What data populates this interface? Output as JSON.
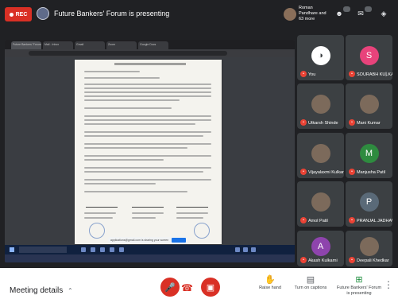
{
  "topbar": {
    "rec_label": "REC",
    "presenting_text": "Future Bankers' Forum is presenting",
    "others_text": "Roman Pandhare and 63 more"
  },
  "shared_screen": {
    "browser_tabs": [
      "Future Bankers' Forum",
      "Mail - Inbox",
      "Gmail",
      "Zoom",
      "Google Docs"
    ],
    "notification_text": "applications@gmail.com is sharing your screen"
  },
  "participants": [
    {
      "name": "You",
      "initial": "",
      "color": "#ffffff",
      "kind": "self"
    },
    {
      "name": "SOURABH KULKARNI",
      "initial": "S",
      "color": "#e8437b",
      "kind": "letter"
    },
    {
      "name": "Utkarsh Shinde",
      "initial": "",
      "color": "#7c6a5b",
      "kind": "photo"
    },
    {
      "name": "Mani Kumar",
      "initial": "",
      "color": "#7c6a5b",
      "kind": "photo"
    },
    {
      "name": "Vijayalaxmi Kulkarni",
      "initial": "",
      "color": "#7c6a5b",
      "kind": "photo"
    },
    {
      "name": "Manjusha Patil",
      "initial": "M",
      "color": "#2e8b3f",
      "kind": "letter"
    },
    {
      "name": "Amol Patil",
      "initial": "",
      "color": "#7c6a5b",
      "kind": "photo"
    },
    {
      "name": "PRANJAL JADHAV",
      "initial": "P",
      "color": "#5a6a78",
      "kind": "letter"
    },
    {
      "name": "Akash Kulkarni",
      "initial": "A",
      "color": "#8e44ad",
      "kind": "letter"
    },
    {
      "name": "Deepali Khedkar",
      "initial": "",
      "color": "#7c6a5b",
      "kind": "photo"
    }
  ],
  "bottombar": {
    "meeting_details": "Meeting details",
    "raise_hand": "Raise hand",
    "captions": "Turn on captions",
    "presenting": "Future Bankers' Forum is presenting"
  }
}
